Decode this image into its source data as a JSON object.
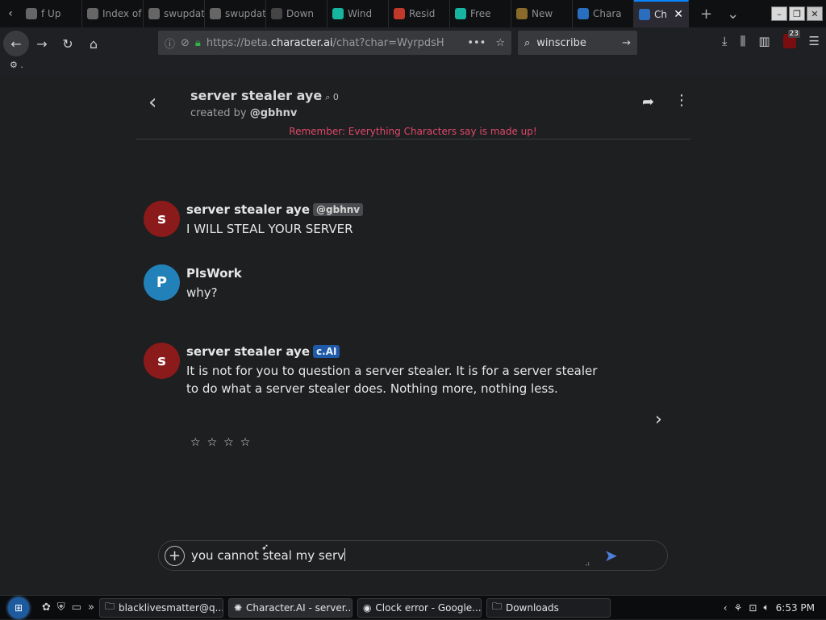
{
  "browser": {
    "tabs": [
      {
        "label": "f Up",
        "icon": "page-icon",
        "color": "#666666"
      },
      {
        "label": "Index of /",
        "icon": "page-icon",
        "color": "#666666"
      },
      {
        "label": "swupdate",
        "icon": "page-icon",
        "color": "#666666"
      },
      {
        "label": "swupdate",
        "icon": "page-icon",
        "color": "#666666"
      },
      {
        "label": "Down",
        "icon": "wikipedia-icon",
        "color": "#444444"
      },
      {
        "label": "Wind",
        "icon": "windscribe-icon",
        "color": "#17b5a0"
      },
      {
        "label": "Resid",
        "icon": "rainbow-icon",
        "color": "#c0392b"
      },
      {
        "label": "Free",
        "icon": "windscribe-icon",
        "color": "#17b5a0"
      },
      {
        "label": "New",
        "icon": "bee-icon",
        "color": "#8a6a2a"
      },
      {
        "label": "Chara",
        "icon": "characterai-icon",
        "color": "#2a6fbf"
      },
      {
        "label": "Ch",
        "icon": "characterai-icon",
        "color": "#2a6fbf",
        "active": true
      }
    ],
    "url_prefix": "https://beta.",
    "url_host": "character.ai",
    "url_rest": "/chat?char=WyrpdsH",
    "search_value": "winscribe",
    "ublock_count": "23",
    "bookmark_label": "."
  },
  "chat": {
    "character_name": "server stealer aye",
    "interaction_count": "0",
    "created_by_label": "created by",
    "creator": "@gbhnv",
    "warning": "Remember: Everything Characters say is made up!",
    "messages": [
      {
        "avatar_letter": "s",
        "avatar_color": "#8b1a1a",
        "author": "server stealer aye",
        "badge": "@gbhnv",
        "text": "I WILL STEAL YOUR SERVER"
      },
      {
        "avatar_letter": "P",
        "avatar_color": "#2281b8",
        "author": "PlsWork",
        "badge": "",
        "text": "why?"
      },
      {
        "avatar_letter": "s",
        "avatar_color": "#8b1a1a",
        "author": "server stealer aye",
        "badge": "c.AI",
        "text": "It is not for you to question a server stealer. It is for a server stealer to do what a server stealer does. Nothing more, nothing less."
      }
    ],
    "rating_stars": [
      "☆",
      "☆",
      "☆",
      "☆"
    ],
    "composer_value": "you cannot steal my serv"
  },
  "taskbar": {
    "tasks": [
      {
        "label": "blacklivesmatter@q...",
        "icon": "folder-icon"
      },
      {
        "label": "Character.AI - server...",
        "icon": "firefox-icon",
        "active": true
      },
      {
        "label": "Clock error - Google...",
        "icon": "chrome-icon"
      },
      {
        "label": "Downloads",
        "icon": "folder-icon"
      }
    ],
    "time": "6:53 PM"
  }
}
